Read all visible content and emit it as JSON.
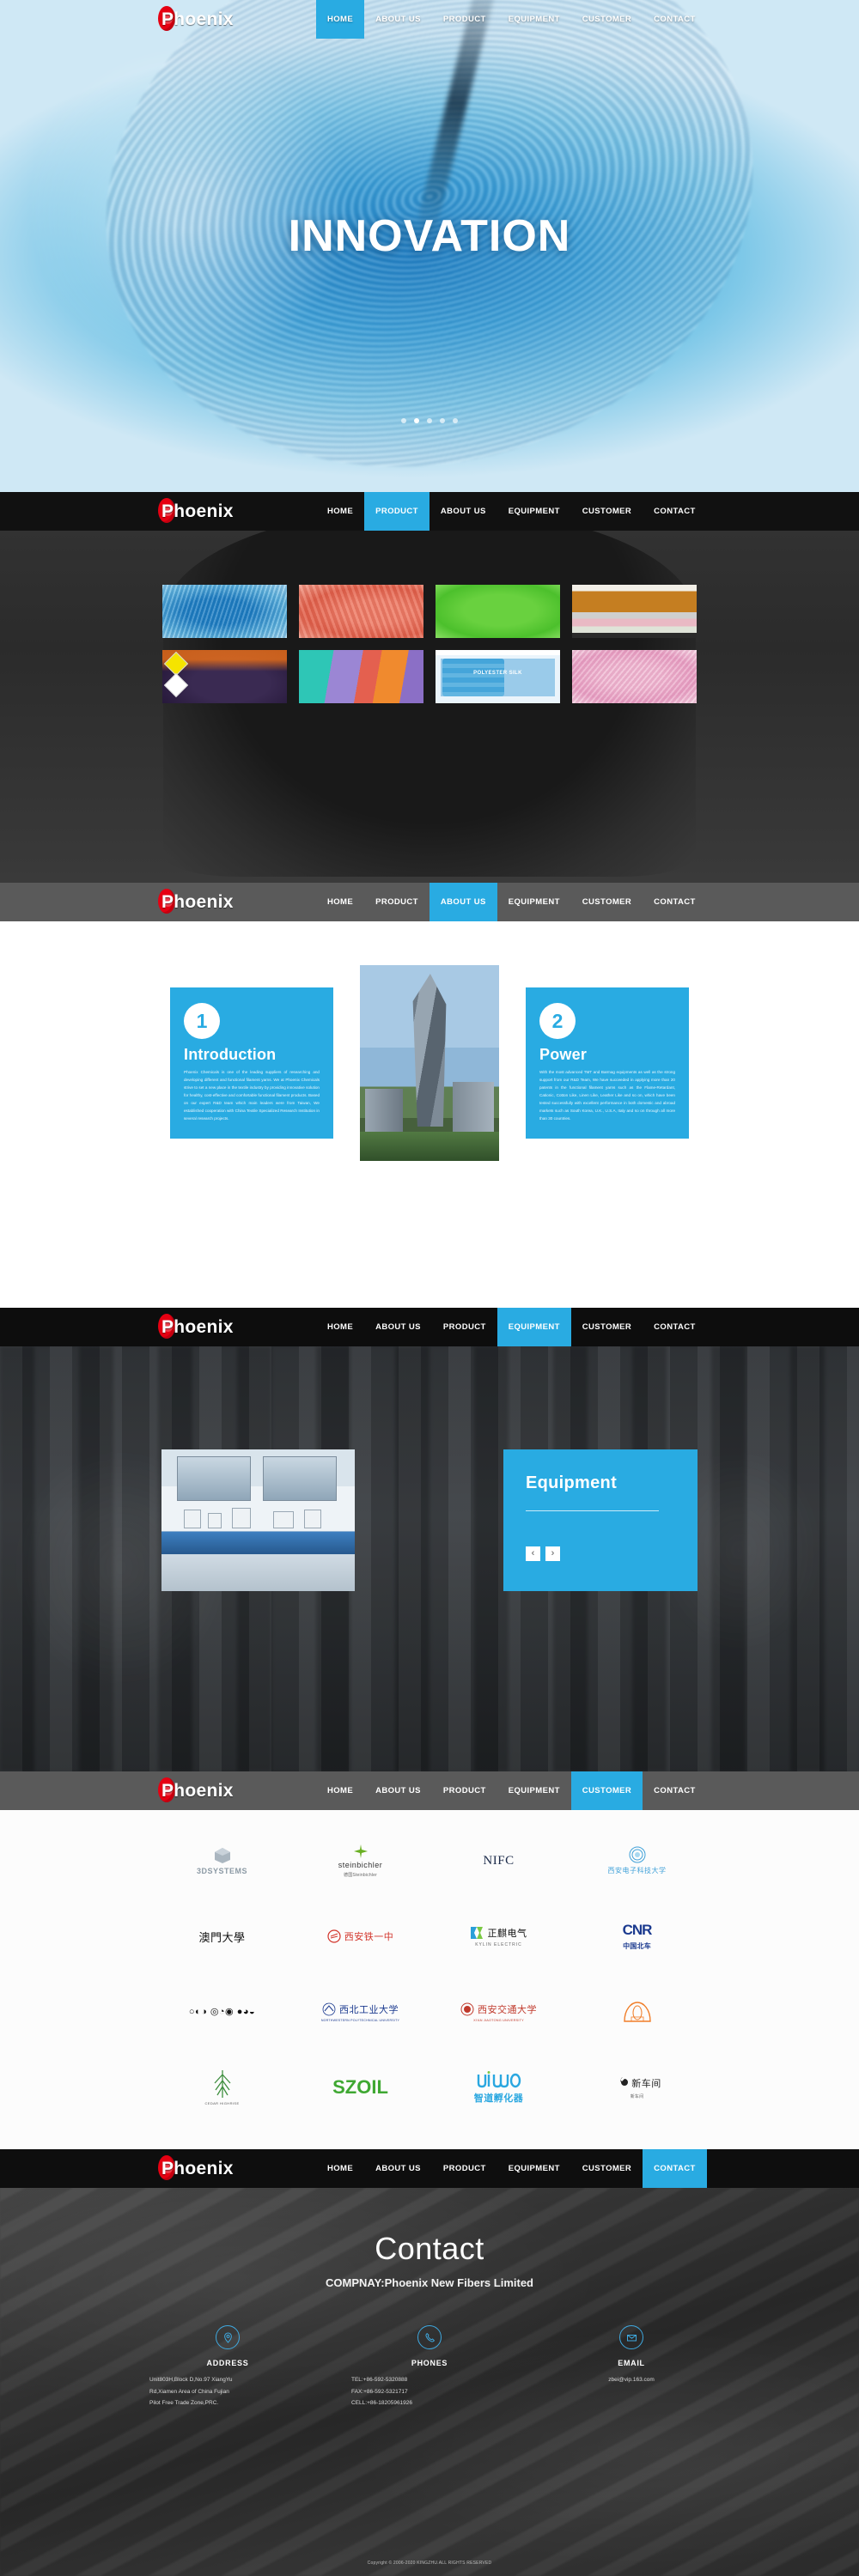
{
  "brand": {
    "name": "Phoenix",
    "logo_icon": "phoenix-red-swoosh-icon"
  },
  "nav": {
    "home": "HOME",
    "about": "ABOUT US",
    "product": "PRODUCT",
    "equipment": "EQUIPMENT",
    "customer": "CUSTOMER",
    "contact": "CONTACT"
  },
  "hero": {
    "title": "INNOVATION",
    "slide_dots": 5,
    "active_dot": 2
  },
  "product": {
    "items": [
      {
        "label": "blue swirl knit fabric"
      },
      {
        "label": "coral draped chiffon"
      },
      {
        "label": "green smooth fabric"
      },
      {
        "label": "folded stack of fleece"
      },
      {
        "label": "flame retardant purple fleece"
      },
      {
        "label": "multicolor fabric swatches"
      },
      {
        "label": "POLYESTER SILK",
        "caption": "POLYESTER SILK"
      },
      {
        "label": "pink swirl fabric"
      }
    ]
  },
  "about": {
    "cards": [
      {
        "number": "1",
        "heading": "Introduction",
        "body": "Phoenix Chemicals is one of the leading suppliers of researching and developing different and functional filament yarns. We at Phoenix Chemicals strive to set a new place in the textile industry by providing innovative solution for healthy, cost-effective and comfortable functional filament products. Based on our expert R&D team which main leaders were from Taiwan, We established cooperation with China Textile Specialized Research Institution in several research projects."
      },
      {
        "number": "2",
        "heading": "Power",
        "body": "With the most advanced TMT and Barmag equipments as well as the strong support from our R&D Team, We have succeeded in applying more than 20 patents in the functional filament yarns such as the Flame-Retardant, Cationic, Cotton Like, Linen Like, Leather Like and so on, which have been tested successfully with excellent performance in both domestic and abroad markets such as South Korea, U.K., U.S.A, Italy and so on through all more than 30 countries."
      }
    ],
    "photo_alt": "skyscraper building photo"
  },
  "equipment": {
    "title": "Equipment",
    "prev_label": "‹",
    "next_label": "›",
    "photo_alt": "laboratory equipment room"
  },
  "customer": {
    "logos": [
      {
        "text": "3DSYSTEMS",
        "sub": "",
        "color": "#8c9aa5"
      },
      {
        "text": "steinbichler",
        "sub": "德国Steinbichler",
        "color": "#333333"
      },
      {
        "text": "NIFC",
        "sub": "",
        "color": "#1c2b4a"
      },
      {
        "text": "西安电子科技大学",
        "sub": "",
        "color": "#3fa0d8"
      },
      {
        "text": "澳門大學",
        "sub": "",
        "color": "#111111"
      },
      {
        "text": "西安铁一中",
        "sub": "",
        "color": "#d2342a"
      },
      {
        "text": "正麒电气",
        "sub": "KYLIN ELECTRIC",
        "color": "#111111"
      },
      {
        "text": "CNR",
        "sub": "中国北车",
        "color": "#1b3a8f"
      },
      {
        "text": "○◐◑ ◎◔◉ ●◕◒",
        "sub": "",
        "color": "#111111"
      },
      {
        "text": "西北工业大学",
        "sub": "NORTHWESTERN POLYTECHNICAL UNIVERSITY",
        "color": "#1b3a8f"
      },
      {
        "text": "西安交通大学",
        "sub": "XI'AN JIAOTONG UNIVERSITY",
        "color": "#c0392b"
      },
      {
        "text": "安全帽",
        "sub": "",
        "color": "#f07d28"
      },
      {
        "text": "CEDAR HIGHRISE",
        "sub": "CEDAR HIGHRISE",
        "color": "#3f8f3f"
      },
      {
        "text": "SZOIL",
        "sub": "",
        "color": "#3fa832"
      },
      {
        "text": "智道孵化器",
        "sub": "智道孵化器",
        "color": "#2aa7e0"
      },
      {
        "text": "新车间",
        "sub": "新车间",
        "color": "#222222"
      }
    ]
  },
  "contact": {
    "title": "Contact",
    "company": "COMPNAY:Phoenix New Fibers Limited",
    "address": {
      "icon": "location-pin-icon",
      "label": "ADDRESS",
      "lines": [
        "Unit803H,Block D,No.97 XiangYu",
        "Rd,Xiamen Area of China Fujian",
        "Pilot Free Trade Zone,PRC."
      ]
    },
    "phones": {
      "icon": "phone-icon",
      "label": "PHONES",
      "lines": [
        "TEL:+86-592-5320888",
        "FAX:+86-592-5321717",
        "CELL:+86-18205961926"
      ]
    },
    "email": {
      "icon": "envelope-icon",
      "label": "EMAIL",
      "lines": [
        "zbei@vip.163.com"
      ]
    },
    "copyright": "Copyright © 2006-2020 KINGZHU.ALL RIGHTS RESERVED"
  },
  "colors": {
    "accent": "#29abe2",
    "accent_light": "#3fa9e0",
    "logo_red": "#e60012",
    "nav_dark": "#111111",
    "nav_gray": "#5a5a5a"
  }
}
